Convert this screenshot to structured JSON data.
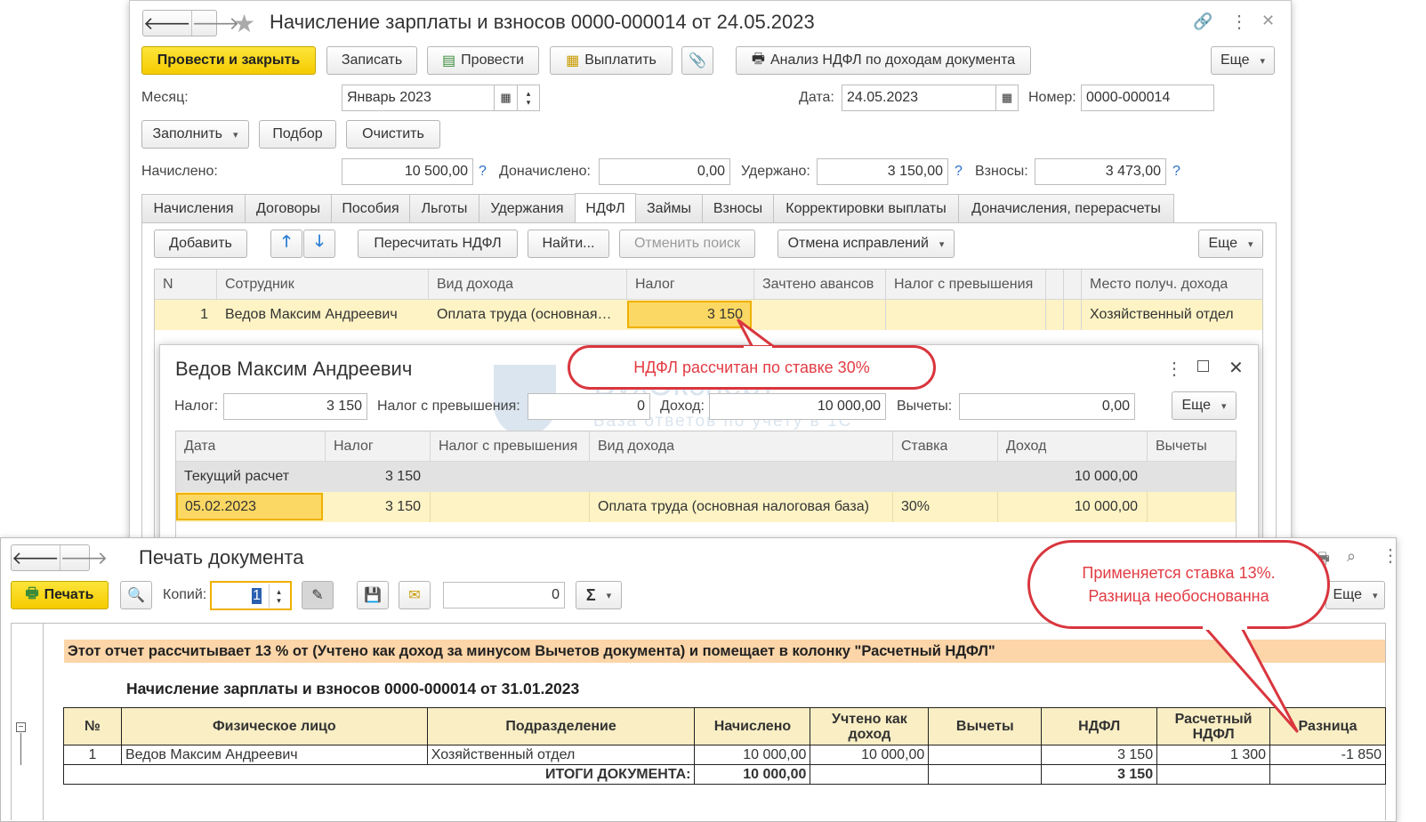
{
  "doc": {
    "title": "Начисление зарплаты и взносов 0000-000014 от 24.05.2023",
    "buttons": {
      "post_close": "Провести и закрыть",
      "save": "Записать",
      "post": "Провести",
      "pay": "Выплатить",
      "analysis": "Анализ НДФЛ по доходам документа",
      "more": "Еще"
    },
    "month_label": "Месяц:",
    "month_value": "Январь 2023",
    "date_label": "Дата:",
    "date_value": "24.05.2023",
    "number_label": "Номер:",
    "number_value": "0000-000014",
    "fill": "Заполнить",
    "select": "Подбор",
    "clear": "Очистить",
    "accrued_label": "Начислено:",
    "accrued_value": "10 500,00",
    "extra_label": "Доначислено:",
    "extra_value": "0,00",
    "withheld_label": "Удержано:",
    "withheld_value": "3 150,00",
    "contrib_label": "Взносы:",
    "contrib_value": "3 473,00",
    "help": "?",
    "tabs": [
      "Начисления",
      "Договоры",
      "Пособия",
      "Льготы",
      "Удержания",
      "НДФЛ",
      "Займы",
      "Взносы",
      "Корректировки выплаты",
      "Доначисления, перерасчеты"
    ],
    "toolbar": {
      "add": "Добавить",
      "recalc": "Пересчитать НДФЛ",
      "find": "Найти...",
      "cancel_search": "Отменить поиск",
      "cancel_fix": "Отмена исправлений",
      "more": "Еще"
    },
    "grid": {
      "headers": [
        "N",
        "Сотрудник",
        "Вид дохода",
        "Налог",
        "Зачтено авансов",
        "Налог с превышения",
        "Место получ. дохода"
      ],
      "row": {
        "n": "1",
        "employee": "Ведов Максим Андреевич",
        "income_type": "Оплата труда (основная…",
        "tax": "3 150",
        "place": "Хозяйственный отдел"
      }
    }
  },
  "callout1": "НДФЛ рассчитан по ставке 30%",
  "detail": {
    "title": "Ведов Максим Андреевич",
    "tax_label": "Налог:",
    "tax_value": "3 150",
    "excess_label": "Налог с превышения:",
    "excess_value": "0",
    "income_label": "Доход:",
    "income_value": "10 000,00",
    "deductions_label": "Вычеты:",
    "deductions_value": "0,00",
    "more": "Еще",
    "headers": [
      "Дата",
      "Налог",
      "Налог с превышения",
      "Вид дохода",
      "Ставка",
      "Доход",
      "Вычеты"
    ],
    "current_row": {
      "label": "Текущий расчет",
      "tax": "3 150",
      "income": "10 000,00"
    },
    "row": {
      "date": "05.02.2023",
      "tax": "3 150",
      "income_type": "Оплата труда (основная налоговая база)",
      "rate": "30%",
      "income": "10 000,00"
    }
  },
  "watermark": {
    "brand": "БухЭксперт",
    "tagline": "База ответов по учету в 1С"
  },
  "print": {
    "title": "Печать документа",
    "print_btn": "Печать",
    "copies_label": "Копий:",
    "copies_value": "1",
    "sum_value": "0",
    "sigma": "Σ",
    "more": "Еще",
    "note": "Этот отчет рассчитывает 13 % от (Учтено как доход за минусом Вычетов документа)  и помещает в колонку \"Расчетный НДФЛ\"",
    "report_title": "Начисление зарплаты и взносов 0000-000014 от 31.01.2023",
    "headers": [
      "№",
      "Физическое лицо",
      "Подразделение",
      "Начислено",
      "Учтено как доход",
      "Вычеты",
      "НДФЛ",
      "Расчетный НДФЛ",
      "Разница"
    ],
    "row": [
      "1",
      "Ведов Максим Андреевич",
      "Хозяйственный отдел",
      "10 000,00",
      "10 000,00",
      "",
      "3 150",
      "1 300",
      "-1 850"
    ],
    "totals_label": "ИТОГИ ДОКУМЕНТА:",
    "totals_accrued": "10 000,00",
    "totals_tax": "3 150"
  },
  "callout2_line1": "Применяется ставка 13%.",
  "callout2_line2": "Разница необоснованна",
  "colors": {
    "accent_yellow": "#f5cb00",
    "row_highlight": "#fdf3c4",
    "callout_red": "#d9363e",
    "note_bg": "#fcd5a8"
  }
}
